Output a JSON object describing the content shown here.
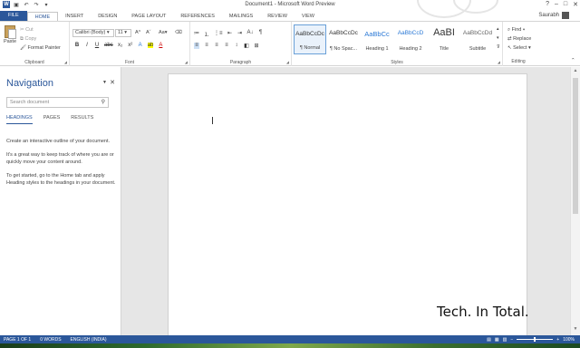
{
  "window": {
    "title": "Document1 - Microsoft Word Preview",
    "controls": [
      "?",
      "–",
      "□",
      "✕"
    ]
  },
  "tabs": [
    "FILE",
    "HOME",
    "INSERT",
    "DESIGN",
    "PAGE LAYOUT",
    "REFERENCES",
    "MAILINGS",
    "REVIEW",
    "VIEW"
  ],
  "user": "Saurabh",
  "clipboard": {
    "paste": "Paste",
    "cut": "Cut",
    "copy": "Copy",
    "format_painter": "Format Painter",
    "label": "Clipboard"
  },
  "font": {
    "name": "Calibri (Body)",
    "size": "11",
    "case": "Aa",
    "label": "Font",
    "row2": [
      "B",
      "I",
      "U",
      "abc",
      "x₂",
      "x²",
      "A",
      "ab",
      "A"
    ]
  },
  "paragraph": {
    "label": "Paragraph",
    "row1": [
      "≔",
      "⒈",
      "⋮≡",
      "⇤",
      "⇥",
      "A↓",
      "¶"
    ],
    "row2": [
      "≡",
      "≡",
      "≡",
      "≡",
      "↕",
      "◧",
      "⊞"
    ]
  },
  "styles": {
    "label": "Styles",
    "items": [
      {
        "preview": "AaBbCcDc",
        "name": "¶ Normal"
      },
      {
        "preview": "AaBbCcDc",
        "name": "¶ No Spac..."
      },
      {
        "preview": "AaBbCc",
        "name": "Heading 1"
      },
      {
        "preview": "AaBbCcD",
        "name": "Heading 2"
      },
      {
        "preview": "AaBI",
        "name": "Title"
      },
      {
        "preview": "AaBbCcDd",
        "name": "Subtitle"
      }
    ]
  },
  "editing": {
    "find": "Find",
    "replace": "Replace",
    "select": "Select",
    "label": "Editing"
  },
  "navigation": {
    "title": "Navigation",
    "search_placeholder": "Search document",
    "tabs": [
      "HEADINGS",
      "PAGES",
      "RESULTS"
    ],
    "help": [
      "Create an interactive outline of your document.",
      "It's a great way to keep track of where you are or quickly move your content around.",
      "To get started, go to the Home tab and apply Heading styles to the headings in your document."
    ]
  },
  "watermark": "Tech. In Total.",
  "status": {
    "page": "PAGE 1 OF 1",
    "words": "0 WORDS",
    "language": "ENGLISH (INDIA)",
    "zoom": "100%"
  },
  "colors": {
    "accent": "#2b579a"
  }
}
